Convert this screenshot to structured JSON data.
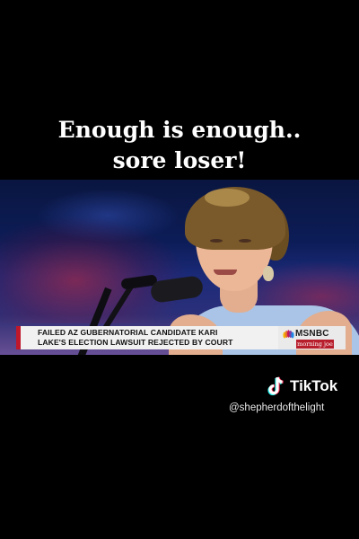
{
  "caption": {
    "line1": "Enough is enough..",
    "line2": "sore loser!"
  },
  "video": {
    "lower_third": {
      "headline_line1": "FAILED AZ GUBERNATORIAL CANDIDATE KARI",
      "headline_line2": "LAKE'S ELECTION LAWSUIT REJECTED BY COURT",
      "network": "MSNBC",
      "program": "morning joe",
      "accent_color": "#c0172b"
    }
  },
  "watermark": {
    "brand": "TikTok",
    "handle": "@shepherdofthelight",
    "icon": "tiktok-logo-icon"
  },
  "colors": {
    "background": "#000000",
    "caption_text": "#ffffff"
  }
}
